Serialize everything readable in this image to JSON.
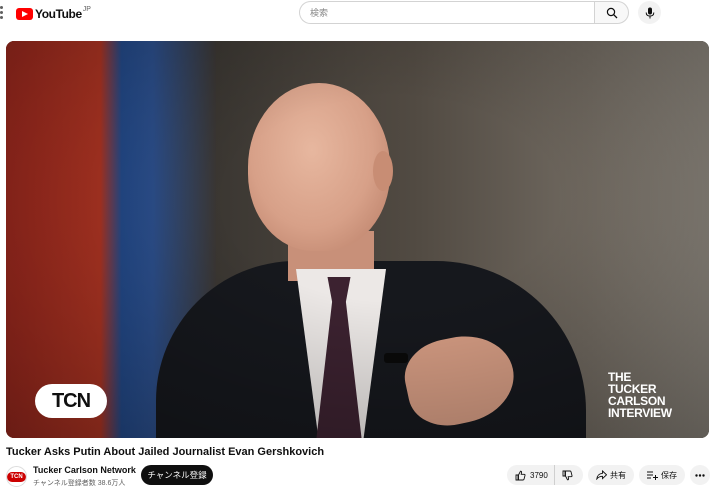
{
  "header": {
    "logo_text": "YouTube",
    "logo_suffix": "JP",
    "search_placeholder": "検索"
  },
  "video": {
    "overlay_logo": "TCN",
    "watermark_lines": [
      "THE",
      "TUCKER",
      "CARLSON",
      "INTERVIEW"
    ]
  },
  "title": "Tucker Asks Putin About Jailed Journalist Evan Gershkovich",
  "channel": {
    "avatar_text": "TCN",
    "name": "Tucker Carlson Network",
    "subscribers": "チャンネル登録者数 38.6万人",
    "subscribe_label": "チャンネル登録"
  },
  "actions": {
    "like_count": "3790",
    "share_label": "共有",
    "save_label": "保存"
  },
  "colors": {
    "brand_red": "#ff0000",
    "subscribe_bg": "#0f0f0f",
    "pill_bg": "#f2f2f2"
  }
}
